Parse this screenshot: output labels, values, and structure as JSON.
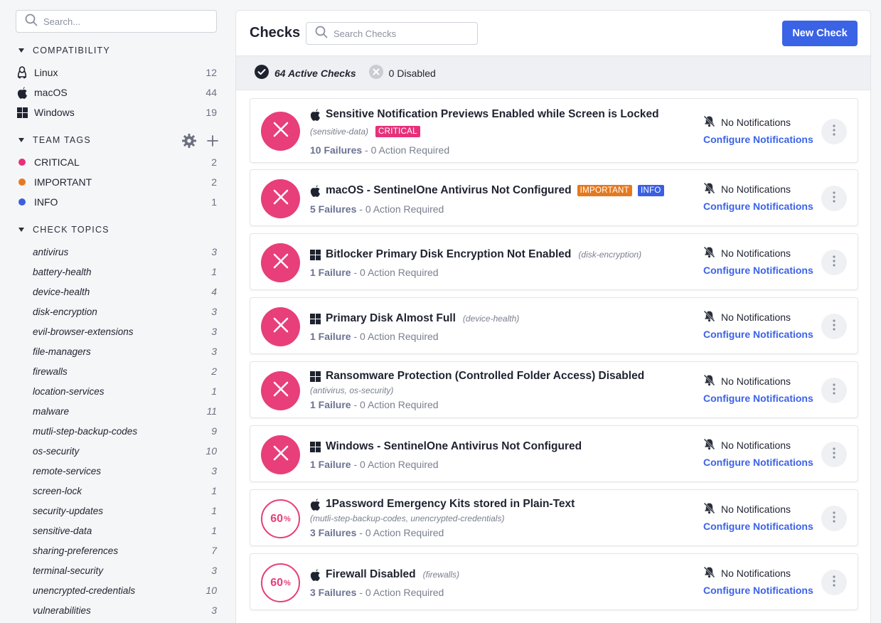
{
  "sidebar": {
    "search_placeholder": "Search...",
    "compatibility": {
      "title": "COMPATIBILITY",
      "items": [
        {
          "label": "Linux",
          "count": "12",
          "icon": "linux-icon"
        },
        {
          "label": "macOS",
          "count": "44",
          "icon": "apple-icon"
        },
        {
          "label": "Windows",
          "count": "19",
          "icon": "windows-icon"
        }
      ]
    },
    "team_tags": {
      "title": "TEAM TAGS",
      "items": [
        {
          "label": "CRITICAL",
          "count": "2",
          "color": "#e8307a"
        },
        {
          "label": "IMPORTANT",
          "count": "2",
          "color": "#e5791f"
        },
        {
          "label": "INFO",
          "count": "1",
          "color": "#3b5fe0"
        }
      ]
    },
    "check_topics": {
      "title": "CHECK TOPICS",
      "items": [
        {
          "label": "antivirus",
          "count": "3"
        },
        {
          "label": "battery-health",
          "count": "1"
        },
        {
          "label": "device-health",
          "count": "4"
        },
        {
          "label": "disk-encryption",
          "count": "3"
        },
        {
          "label": "evil-browser-extensions",
          "count": "3"
        },
        {
          "label": "file-managers",
          "count": "3"
        },
        {
          "label": "firewalls",
          "count": "2"
        },
        {
          "label": "location-services",
          "count": "1"
        },
        {
          "label": "malware",
          "count": "11"
        },
        {
          "label": "mutli-step-backup-codes",
          "count": "9"
        },
        {
          "label": "os-security",
          "count": "10"
        },
        {
          "label": "remote-services",
          "count": "3"
        },
        {
          "label": "screen-lock",
          "count": "1"
        },
        {
          "label": "security-updates",
          "count": "1"
        },
        {
          "label": "sensitive-data",
          "count": "1"
        },
        {
          "label": "sharing-preferences",
          "count": "7"
        },
        {
          "label": "terminal-security",
          "count": "3"
        },
        {
          "label": "unencrypted-credentials",
          "count": "10"
        },
        {
          "label": "vulnerabilities",
          "count": "3"
        }
      ]
    }
  },
  "header": {
    "title": "Checks",
    "search_placeholder": "Search Checks",
    "new_button": "New Check"
  },
  "status": {
    "active": "64 Active Checks",
    "disabled": "0 Disabled"
  },
  "checks": [
    {
      "os": "apple",
      "status": "fail",
      "name": "Sensitive Notification Previews Enabled while Screen is Locked",
      "topics_below": "(sensitive-data)",
      "badges": [
        "CRITICAL"
      ],
      "failures": "10 Failures",
      "action": " - 0 Action Required",
      "notif": "No Notifications",
      "config": "Configure Notifications"
    },
    {
      "os": "apple",
      "status": "fail",
      "name": "macOS - SentinelOne Antivirus Not Configured",
      "badges_inline": [
        "IMPORTANT",
        "INFO"
      ],
      "failures": "5 Failures",
      "action": " - 0 Action Required",
      "notif": "No Notifications",
      "config": "Configure Notifications"
    },
    {
      "os": "windows",
      "status": "fail",
      "name": "Bitlocker Primary Disk Encryption Not Enabled",
      "topics_inline": "(disk-encryption)",
      "failures": "1 Failure",
      "action": " - 0 Action Required",
      "notif": "No Notifications",
      "config": "Configure Notifications"
    },
    {
      "os": "windows",
      "status": "fail",
      "name": "Primary Disk Almost Full",
      "topics_inline": "(device-health)",
      "failures": "1 Failure",
      "action": " - 0 Action Required",
      "notif": "No Notifications",
      "config": "Configure Notifications"
    },
    {
      "os": "windows",
      "status": "fail",
      "name": "Ransomware Protection (Controlled Folder Access) Disabled",
      "topics_below": "(antivirus, os-security)",
      "failures": "1 Failure",
      "action": " - 0 Action Required",
      "notif": "No Notifications",
      "config": "Configure Notifications"
    },
    {
      "os": "windows",
      "status": "fail",
      "name": "Windows - SentinelOne Antivirus Not Configured",
      "failures": "1 Failure",
      "action": " - 0 Action Required",
      "notif": "No Notifications",
      "config": "Configure Notifications"
    },
    {
      "os": "apple",
      "status": "pct",
      "pct": "60",
      "pct_unit": "%",
      "name": "1Password Emergency Kits stored in Plain-Text",
      "topics_below": "(mutli-step-backup-codes, unencrypted-credentials)",
      "failures": "3 Failures",
      "action": " - 0 Action Required",
      "notif": "No Notifications",
      "config": "Configure Notifications"
    },
    {
      "os": "apple",
      "status": "pct",
      "pct": "60",
      "pct_unit": "%",
      "name": "Firewall Disabled",
      "topics_inline": "(firewalls)",
      "failures": "3 Failures",
      "action": " - 0 Action Required",
      "notif": "No Notifications",
      "config": "Configure Notifications"
    }
  ],
  "colors": {
    "accent": "#3b63e6",
    "fail": "#e83e7a",
    "critical": "#e8307a",
    "important": "#e5791f",
    "info": "#3b5fe0"
  }
}
